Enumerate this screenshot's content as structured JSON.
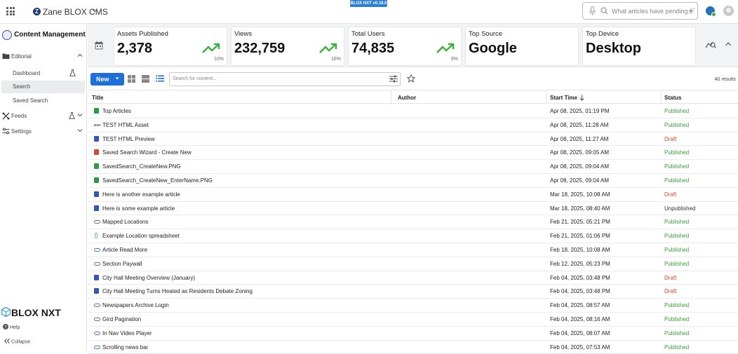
{
  "topbar": {
    "site_logo": "Z",
    "site_name": "Zane BLOX CMS",
    "version": "BLOX NXT v0.18.0",
    "search_placeholder": "What articles have pending...",
    "icons": [
      "apps-grid-icon",
      "chevron-down-icon",
      "microphone-icon",
      "search-icon",
      "sparkle-icon",
      "notification-icon",
      "user-avatar-icon"
    ]
  },
  "sidebar": {
    "title": "Content Management",
    "sections": [
      {
        "label": "Editorial",
        "icon": "editorial-icon",
        "expanded": true,
        "items": [
          {
            "label": "Dashboard"
          },
          {
            "label": "Search",
            "selected": true
          },
          {
            "label": "Saved Search"
          }
        ]
      },
      {
        "label": "Feeds",
        "icon": "feeds-icon"
      },
      {
        "label": "Settings",
        "icon": "settings-icon"
      }
    ],
    "brand": "BLOX NXT",
    "help": "Help",
    "collapse": "Collapse"
  },
  "stats": [
    {
      "label": "Assets Published",
      "value": "2,378",
      "pct": "10%",
      "trend": "up"
    },
    {
      "label": "Views",
      "value": "232,759",
      "pct": "18%",
      "trend": "up"
    },
    {
      "label": "Total Users",
      "value": "74,835",
      "pct": "9%",
      "trend": "up"
    },
    {
      "label": "Top Source",
      "value": "Google"
    },
    {
      "label": "Top Device",
      "value": "Desktop"
    }
  ],
  "toolbar": {
    "new_label": "New",
    "search_placeholder": "Search for content...",
    "results": "40 results"
  },
  "table": {
    "columns": [
      "Title",
      "Author",
      "Start Time",
      "Status"
    ],
    "sort_column": "Start Time",
    "sort_direction": "descending",
    "rows": [
      {
        "icon": "image",
        "title": "Top Articles",
        "date": "Apr 08, 2025, 01:19 PM",
        "status": "Published"
      },
      {
        "icon": "html",
        "title": "TEST HTML Asset",
        "date": "Apr 08, 2025, 11:28 AM",
        "status": "Published"
      },
      {
        "icon": "doc",
        "title": "TEST HTML Preview",
        "date": "Apr 08, 2025, 11:27 AM",
        "status": "Draft"
      },
      {
        "icon": "gallery",
        "title": "Saved Search Wizard - Create New",
        "date": "Apr 08, 2025, 09:05 AM",
        "status": "Published"
      },
      {
        "icon": "image",
        "title": "SavedSearch_CreateNew.PNG",
        "date": "Apr 08, 2025, 09:04 AM",
        "status": "Published"
      },
      {
        "icon": "image",
        "title": "SavedSearch_CreateNew_EnterName.PNG",
        "date": "Apr 08, 2025, 09:04 AM",
        "status": "Published"
      },
      {
        "icon": "doc",
        "title": "Here is another example article",
        "date": "Mar 18, 2025, 10:08 AM",
        "status": "Draft"
      },
      {
        "icon": "doc",
        "title": "Here is some example article",
        "date": "Mar 18, 2025, 08:40 AM",
        "status": "Unpublished"
      },
      {
        "icon": "link",
        "title": "Mapped Locations",
        "date": "Feb 21, 2025, 05:21 PM",
        "status": "Published"
      },
      {
        "icon": "file",
        "title": "Example Location spreadsheet",
        "date": "Feb 21, 2025, 01:06 PM",
        "status": "Published"
      },
      {
        "icon": "link",
        "title": "Article Read More",
        "date": "Feb 18, 2025, 10:08 AM",
        "status": "Published"
      },
      {
        "icon": "link",
        "title": "Section Paywall",
        "date": "Feb 12, 2025, 05:23 PM",
        "status": "Published"
      },
      {
        "icon": "doc",
        "title": "City Hall Meeting Overview (January)",
        "date": "Feb 04, 2025, 03:48 PM",
        "status": "Draft"
      },
      {
        "icon": "doc",
        "title": "City Hall Meeting Turns Heated as Residents Debate Zoning",
        "date": "Feb 04, 2025, 03:48 PM",
        "status": "Draft"
      },
      {
        "icon": "link",
        "title": "Newspapers Archive Login",
        "date": "Feb 04, 2025, 08:57 AM",
        "status": "Published"
      },
      {
        "icon": "link",
        "title": "Gird Pagination",
        "date": "Feb 04, 2025, 08:16 AM",
        "status": "Published"
      },
      {
        "icon": "link",
        "title": "In Nav Video Player",
        "date": "Feb 04, 2025, 08:07 AM",
        "status": "Published"
      },
      {
        "icon": "link",
        "title": "Scrolling news bar",
        "date": "Feb 04, 2025, 07:53 AM",
        "status": "Published"
      }
    ]
  },
  "colors": {
    "accent": "#1e6fd9",
    "published": "#3a9d3a",
    "draft": "#d04a2a",
    "unpublished": "#333333",
    "trend": "#3cae3c"
  }
}
